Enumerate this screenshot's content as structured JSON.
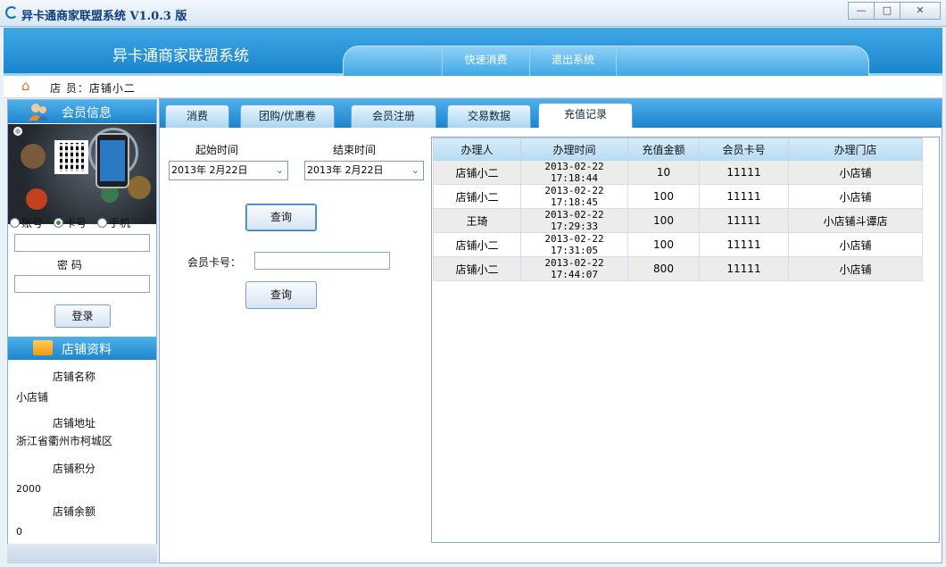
{
  "window": {
    "title": "异卡通商家联盟系统  V1.0.3 版",
    "min_label": "—",
    "max_label": "□",
    "close_label": "✕"
  },
  "banner": {
    "app_title": "异卡通商家联盟系统",
    "nav": [
      {
        "label": "快速消费"
      },
      {
        "label": "退出系统"
      }
    ]
  },
  "address": {
    "label": "店  员：店铺小二"
  },
  "sidebar": {
    "member_header": "会员信息",
    "radios": [
      {
        "label": "账号",
        "checked": false
      },
      {
        "label": "卡号",
        "checked": true
      },
      {
        "label": "手机",
        "checked": false
      }
    ],
    "password_label": "密   码",
    "login_label": "登录",
    "store_header": "店铺资料",
    "store": [
      {
        "label": "店铺名称",
        "value": "小店铺"
      },
      {
        "label": "店铺地址",
        "value": "浙江省衢州市柯城区"
      },
      {
        "label": "店铺积分",
        "value": "2000"
      },
      {
        "label": "店铺余额",
        "value": "0"
      }
    ]
  },
  "tabs": [
    {
      "label": "消费"
    },
    {
      "label": "团购/优惠卷"
    },
    {
      "label": "会员注册"
    },
    {
      "label": "交易数据"
    },
    {
      "label": "充值记录",
      "active": true
    }
  ],
  "query": {
    "start_label": "起始时间",
    "end_label": "结束时间",
    "start_value": "2013年  2月22日",
    "end_value": "2013年  2月22日",
    "query_label": "查询",
    "card_label": "会员卡号：",
    "card_value": "",
    "query2_label": "查询"
  },
  "table": {
    "columns": [
      "办理人",
      "办理时间",
      "充值金额",
      "会员卡号",
      "办理门店"
    ],
    "rows": [
      [
        "店铺小二",
        "2013-02-22 17:18:44",
        "10",
        "11111",
        "小店铺"
      ],
      [
        "店铺小二",
        "2013-02-22 17:18:45",
        "100",
        "11111",
        "小店铺"
      ],
      [
        "王琦",
        "2013-02-22 17:29:33",
        "100",
        "11111",
        "小店铺斗谭店"
      ],
      [
        "店铺小二",
        "2013-02-22 17:31:05",
        "100",
        "11111",
        "小店铺"
      ],
      [
        "店铺小二",
        "2013-02-22 17:44:07",
        "800",
        "11111",
        "小店铺"
      ]
    ]
  },
  "colors": {
    "accent": "#1d86cf",
    "title_text": "#0e3d7a"
  }
}
